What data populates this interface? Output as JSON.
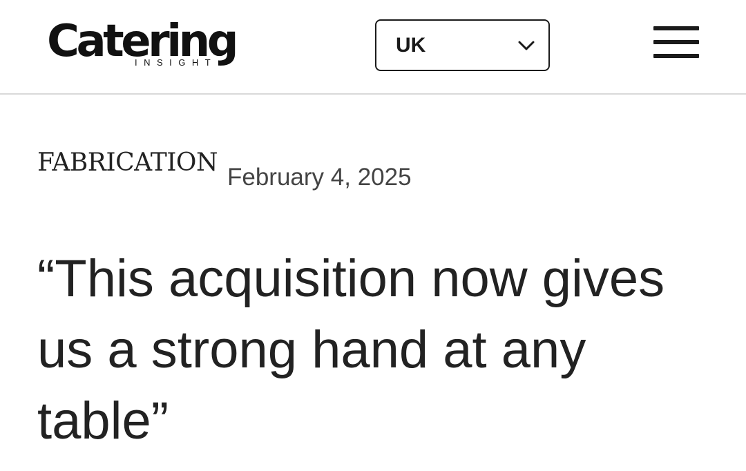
{
  "header": {
    "logo": {
      "word": "Catering",
      "subtitle": "INSIGHT"
    },
    "region_select": {
      "value": "UK",
      "icon": "chevron-down-icon"
    },
    "menu_icon": "hamburger-menu-icon"
  },
  "article": {
    "category": "FABRICATION",
    "date": "February 4, 2025",
    "headline": "“This acquisition now gives us a strong hand at any table”"
  },
  "colors": {
    "text": "#222222",
    "date_text": "#444444",
    "divider": "#d9d9d9",
    "background": "#ffffff"
  }
}
